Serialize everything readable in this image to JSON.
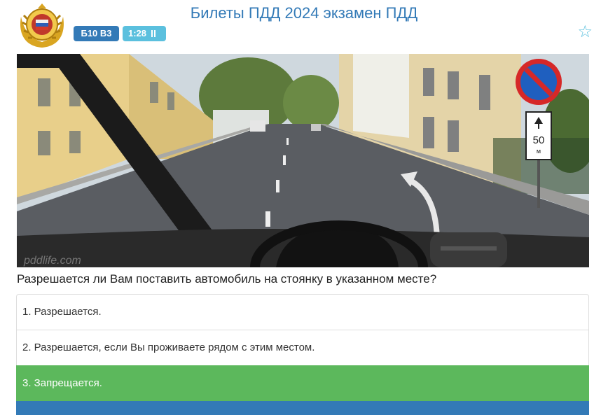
{
  "header": {
    "title": "Билеты ПДД 2024 экзамен ПДД",
    "ticket_badge": "Б10 В3",
    "timer": "1:28",
    "timer_icon": "pause-icon",
    "favorite_icon": "star-outline-icon"
  },
  "question": {
    "image_icon": "road-scene-image",
    "text": "Разрешается ли Вам поставить автомобиль на стоянку в указанном месте?",
    "sign_plate_value": "50",
    "sign_plate_unit": "м",
    "watermark": "pddlife.com"
  },
  "answers": [
    {
      "label": "1. Разрешается.",
      "state": "default"
    },
    {
      "label": "2. Разрешается, если Вы проживаете рядом с этим местом.",
      "state": "default"
    },
    {
      "label": "3. Запрещается.",
      "state": "correct"
    }
  ],
  "colors": {
    "primary": "#337ab7",
    "info": "#5bc0de",
    "success": "#5cb85c"
  }
}
